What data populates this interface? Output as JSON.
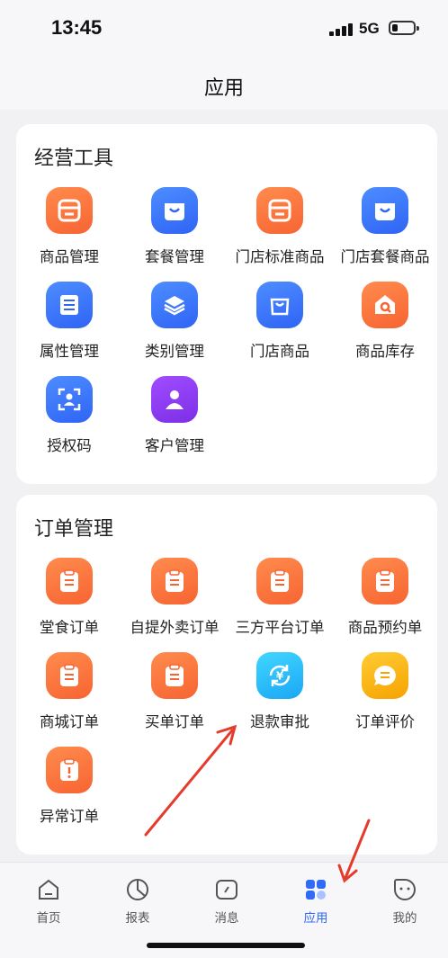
{
  "status_bar": {
    "time": "13:45",
    "network": "5G"
  },
  "header": {
    "title": "应用"
  },
  "sections": [
    {
      "title": "经营工具",
      "items": [
        {
          "label": "商品管理",
          "icon": "product-icon",
          "color": "orange"
        },
        {
          "label": "套餐管理",
          "icon": "bag-icon",
          "color": "blue"
        },
        {
          "label": "门店标准商品",
          "icon": "product-icon",
          "color": "orange"
        },
        {
          "label": "门店套餐商品",
          "icon": "bag-icon",
          "color": "blue"
        },
        {
          "label": "属性管理",
          "icon": "list-icon",
          "color": "blue"
        },
        {
          "label": "类别管理",
          "icon": "layers-icon",
          "color": "blue"
        },
        {
          "label": "门店商品",
          "icon": "shopping-bag-icon",
          "color": "blue"
        },
        {
          "label": "商品库存",
          "icon": "warehouse-icon",
          "color": "orange"
        },
        {
          "label": "授权码",
          "icon": "scan-icon",
          "color": "blue"
        },
        {
          "label": "客户管理",
          "icon": "user-icon",
          "color": "purple"
        }
      ]
    },
    {
      "title": "订单管理",
      "items": [
        {
          "label": "堂食订单",
          "icon": "clipboard-icon",
          "color": "orange"
        },
        {
          "label": "自提外卖订单",
          "icon": "clipboard-icon",
          "color": "orange"
        },
        {
          "label": "三方平台订单",
          "icon": "clipboard-icon",
          "color": "orange"
        },
        {
          "label": "商品预约单",
          "icon": "clipboard-icon",
          "color": "orange"
        },
        {
          "label": "商城订单",
          "icon": "clipboard-icon",
          "color": "orange"
        },
        {
          "label": "买单订单",
          "icon": "clipboard-icon",
          "color": "orange"
        },
        {
          "label": "退款审批",
          "icon": "refund-icon",
          "color": "cyan"
        },
        {
          "label": "订单评价",
          "icon": "comment-icon",
          "color": "amber"
        },
        {
          "label": "异常订单",
          "icon": "alert-clipboard-icon",
          "color": "orange"
        }
      ]
    }
  ],
  "tabbar": {
    "active": "应用",
    "tabs": [
      {
        "label": "首页",
        "icon": "home-icon"
      },
      {
        "label": "报表",
        "icon": "pie-chart-icon"
      },
      {
        "label": "消息",
        "icon": "message-icon"
      },
      {
        "label": "应用",
        "icon": "apps-icon"
      },
      {
        "label": "我的",
        "icon": "profile-icon"
      }
    ]
  },
  "colors": {
    "orange": "#f76432",
    "blue": "#2f64f5",
    "purple": "#7d2ee6",
    "cyan": "#1aa7f5",
    "amber": "#f5a300",
    "active_tab": "#2f6bf5",
    "annotation_arrow": "#e53b2c"
  }
}
